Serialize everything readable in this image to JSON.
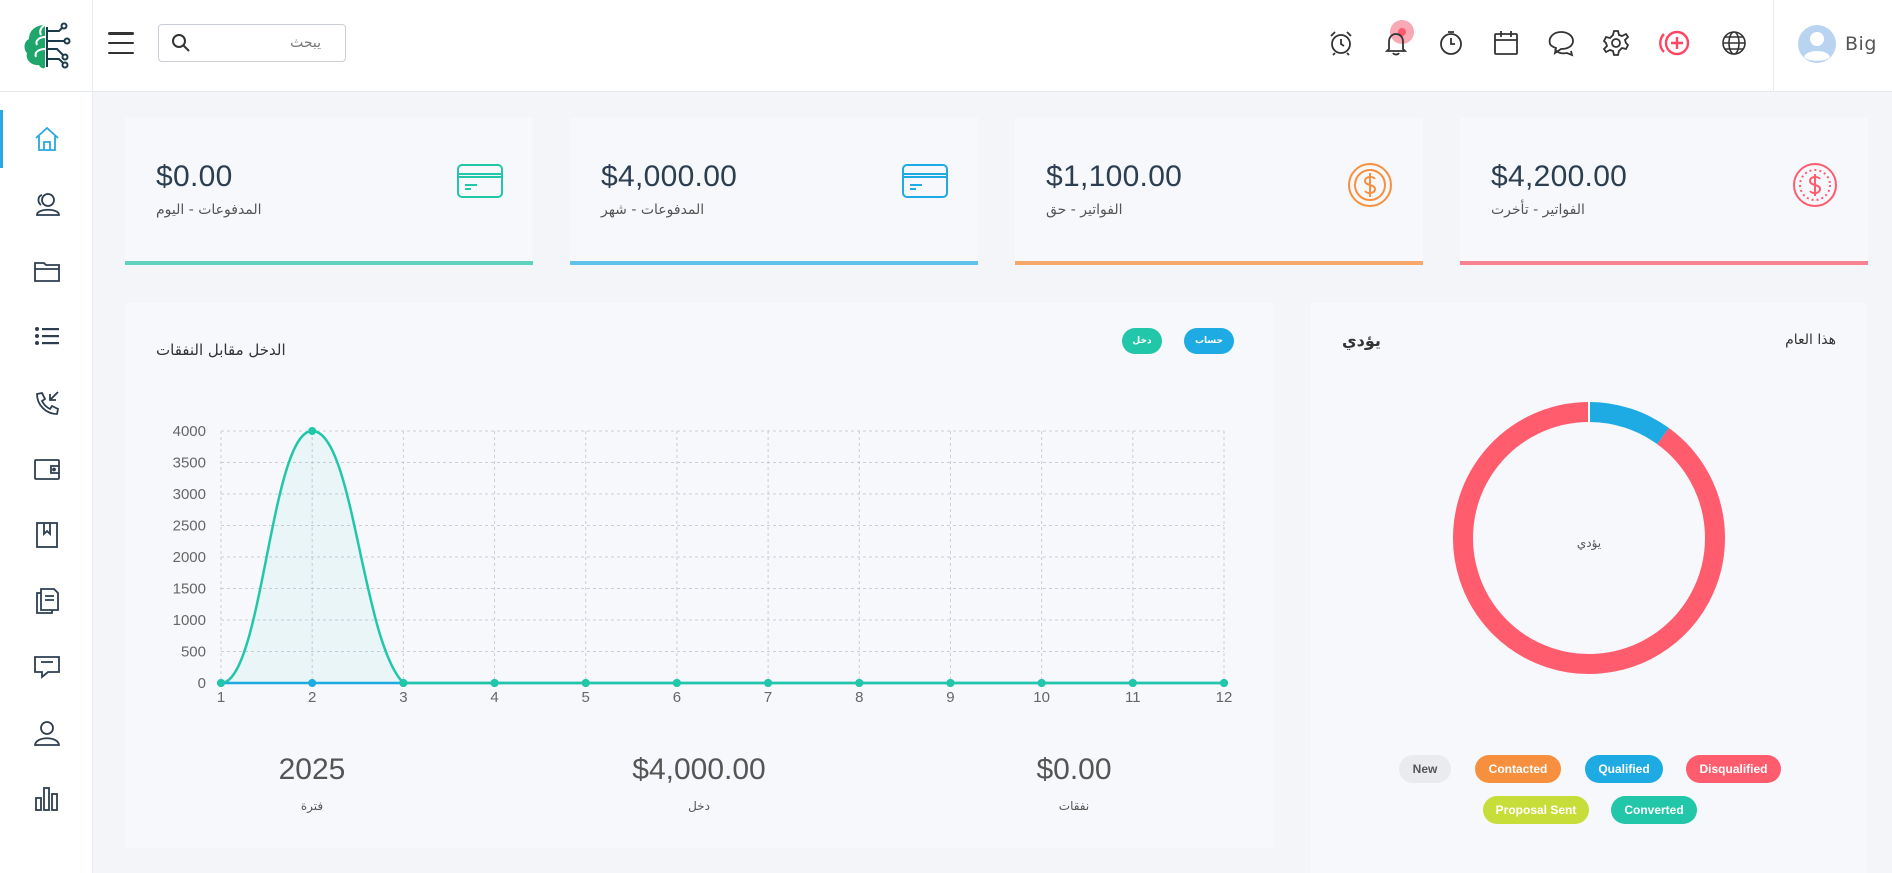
{
  "header": {
    "search_placeholder": "يبحث",
    "user_name": "Big",
    "icons": [
      "alarm-clock-icon",
      "bell-icon",
      "timer-icon",
      "calendar-icon",
      "chat-icon",
      "gear-icon",
      "add-circle-icon",
      "globe-icon"
    ]
  },
  "sidebar": {
    "items": [
      "home-icon",
      "contacts-icon",
      "folder-icon",
      "list-icon",
      "phone-incoming-icon",
      "wallet-icon",
      "book-icon",
      "documents-icon",
      "messages-icon",
      "user-icon",
      "bar-chart-icon"
    ]
  },
  "cards": [
    {
      "value": "$0.00",
      "label": "المدفوعات - اليوم",
      "color": "#5fd3bf",
      "icon": "credit-card-icon"
    },
    {
      "value": "$4,000.00",
      "label": "المدفوعات - شهر",
      "color": "#5ec2ea",
      "icon": "credit-card-icon"
    },
    {
      "value": "$1,100.00",
      "label": "الفواتير - حق",
      "color": "#f6a86a",
      "icon": "dollar-coin-icon"
    },
    {
      "value": "$4,200.00",
      "label": "الفواتير - تأخرت",
      "color": "#f6838f",
      "icon": "dollar-coin-icon"
    }
  ],
  "income_panel": {
    "title": "الدخل مقابل النفقات",
    "btn_account": "حساب",
    "btn_income": "دخل",
    "stats": [
      {
        "value": "2025",
        "label": "فترة"
      },
      {
        "value": "$4,000.00",
        "label": "دخل"
      },
      {
        "value": "$0.00",
        "label": "نفقات"
      }
    ]
  },
  "leads_panel": {
    "title": "يؤدي",
    "period": "هذا العام",
    "center_label": "يؤدي",
    "legend": [
      {
        "label": "New",
        "color": "#e9ebef",
        "text": "#555"
      },
      {
        "label": "Contacted",
        "color": "#f7903e",
        "text": "#fff"
      },
      {
        "label": "Qualified",
        "color": "#1eaae3",
        "text": "#fff"
      },
      {
        "label": "Disqualified",
        "color": "#ff5c6e",
        "text": "#fff"
      },
      {
        "label": "Proposal Sent",
        "color": "#c7dd3a",
        "text": "#fff"
      },
      {
        "label": "Converted",
        "color": "#22c7a9",
        "text": "#fff"
      }
    ]
  },
  "chart_data": [
    {
      "type": "line",
      "x": [
        1,
        2,
        3,
        4,
        5,
        6,
        7,
        8,
        9,
        10,
        11,
        12
      ],
      "series": [
        {
          "name": "دخل",
          "color": "#22c7a9",
          "values": [
            0,
            4000,
            0,
            0,
            0,
            0,
            0,
            0,
            0,
            0,
            0,
            0
          ]
        },
        {
          "name": "حساب",
          "color": "#1eaae3",
          "values": [
            0,
            0,
            0,
            0,
            0,
            0,
            0,
            0,
            0,
            0,
            0,
            0
          ]
        }
      ],
      "ylim": [
        0,
        4000
      ],
      "yticks": [
        0,
        500,
        1000,
        1500,
        2000,
        2500,
        3000,
        3500,
        4000
      ],
      "grid": true
    },
    {
      "type": "pie",
      "donut": true,
      "categories": [
        "Qualified",
        "Disqualified"
      ],
      "values": [
        1,
        9
      ],
      "colors": [
        "#1eaae3",
        "#ff5c6e"
      ]
    }
  ]
}
